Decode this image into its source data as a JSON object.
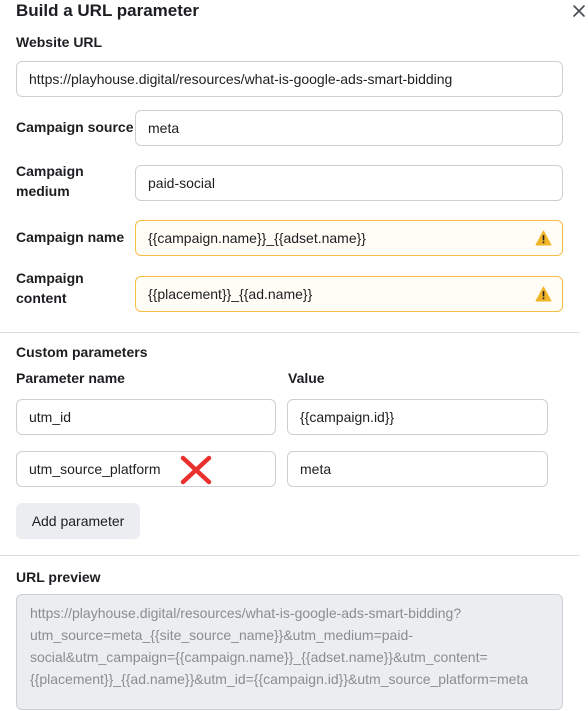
{
  "dialog": {
    "title": "Build a URL parameter",
    "close_icon": "close-icon"
  },
  "website_url": {
    "label": "Website URL",
    "value": "https://playhouse.digital/resources/what-is-google-ads-smart-bidding"
  },
  "campaign_source": {
    "label": "Campaign source",
    "value": "meta"
  },
  "campaign_medium": {
    "label_line1": "Campaign",
    "label_line2": "medium",
    "value": "paid-social"
  },
  "campaign_name": {
    "label": "Campaign name",
    "value": "{{campaign.name}}_{{adset.name}}",
    "status": "warning"
  },
  "campaign_content": {
    "label_line1": "Campaign",
    "label_line2": "content",
    "value": "{{placement}}_{{ad.name}}",
    "status": "warning"
  },
  "custom_parameters": {
    "heading": "Custom parameters",
    "col_name": "Parameter name",
    "col_value": "Value",
    "rows": [
      {
        "name": "utm_id",
        "value": "{{campaign.id}}"
      },
      {
        "name": "utm_source_platform",
        "value": "meta",
        "annotation": "red-x-mark"
      }
    ],
    "add_label": "Add parameter"
  },
  "url_preview": {
    "label": "URL preview",
    "lines": [
      "https://playhouse.digital/resources/what-is-google-ads-smart-bidding?",
      "utm_source=meta_{{site_source_name}}&utm_medium=paid-",
      "social&utm_campaign={{campaign.name}}_{{adset.name}}&utm_content=",
      "{{placement}}_{{ad.name}}&utm_id={{campaign.id}}&utm_source_platform=meta"
    ]
  },
  "colors": {
    "warning_border": "#f5c044",
    "warning_icon": "#f0b429",
    "annotation_red": "#e8312f"
  }
}
